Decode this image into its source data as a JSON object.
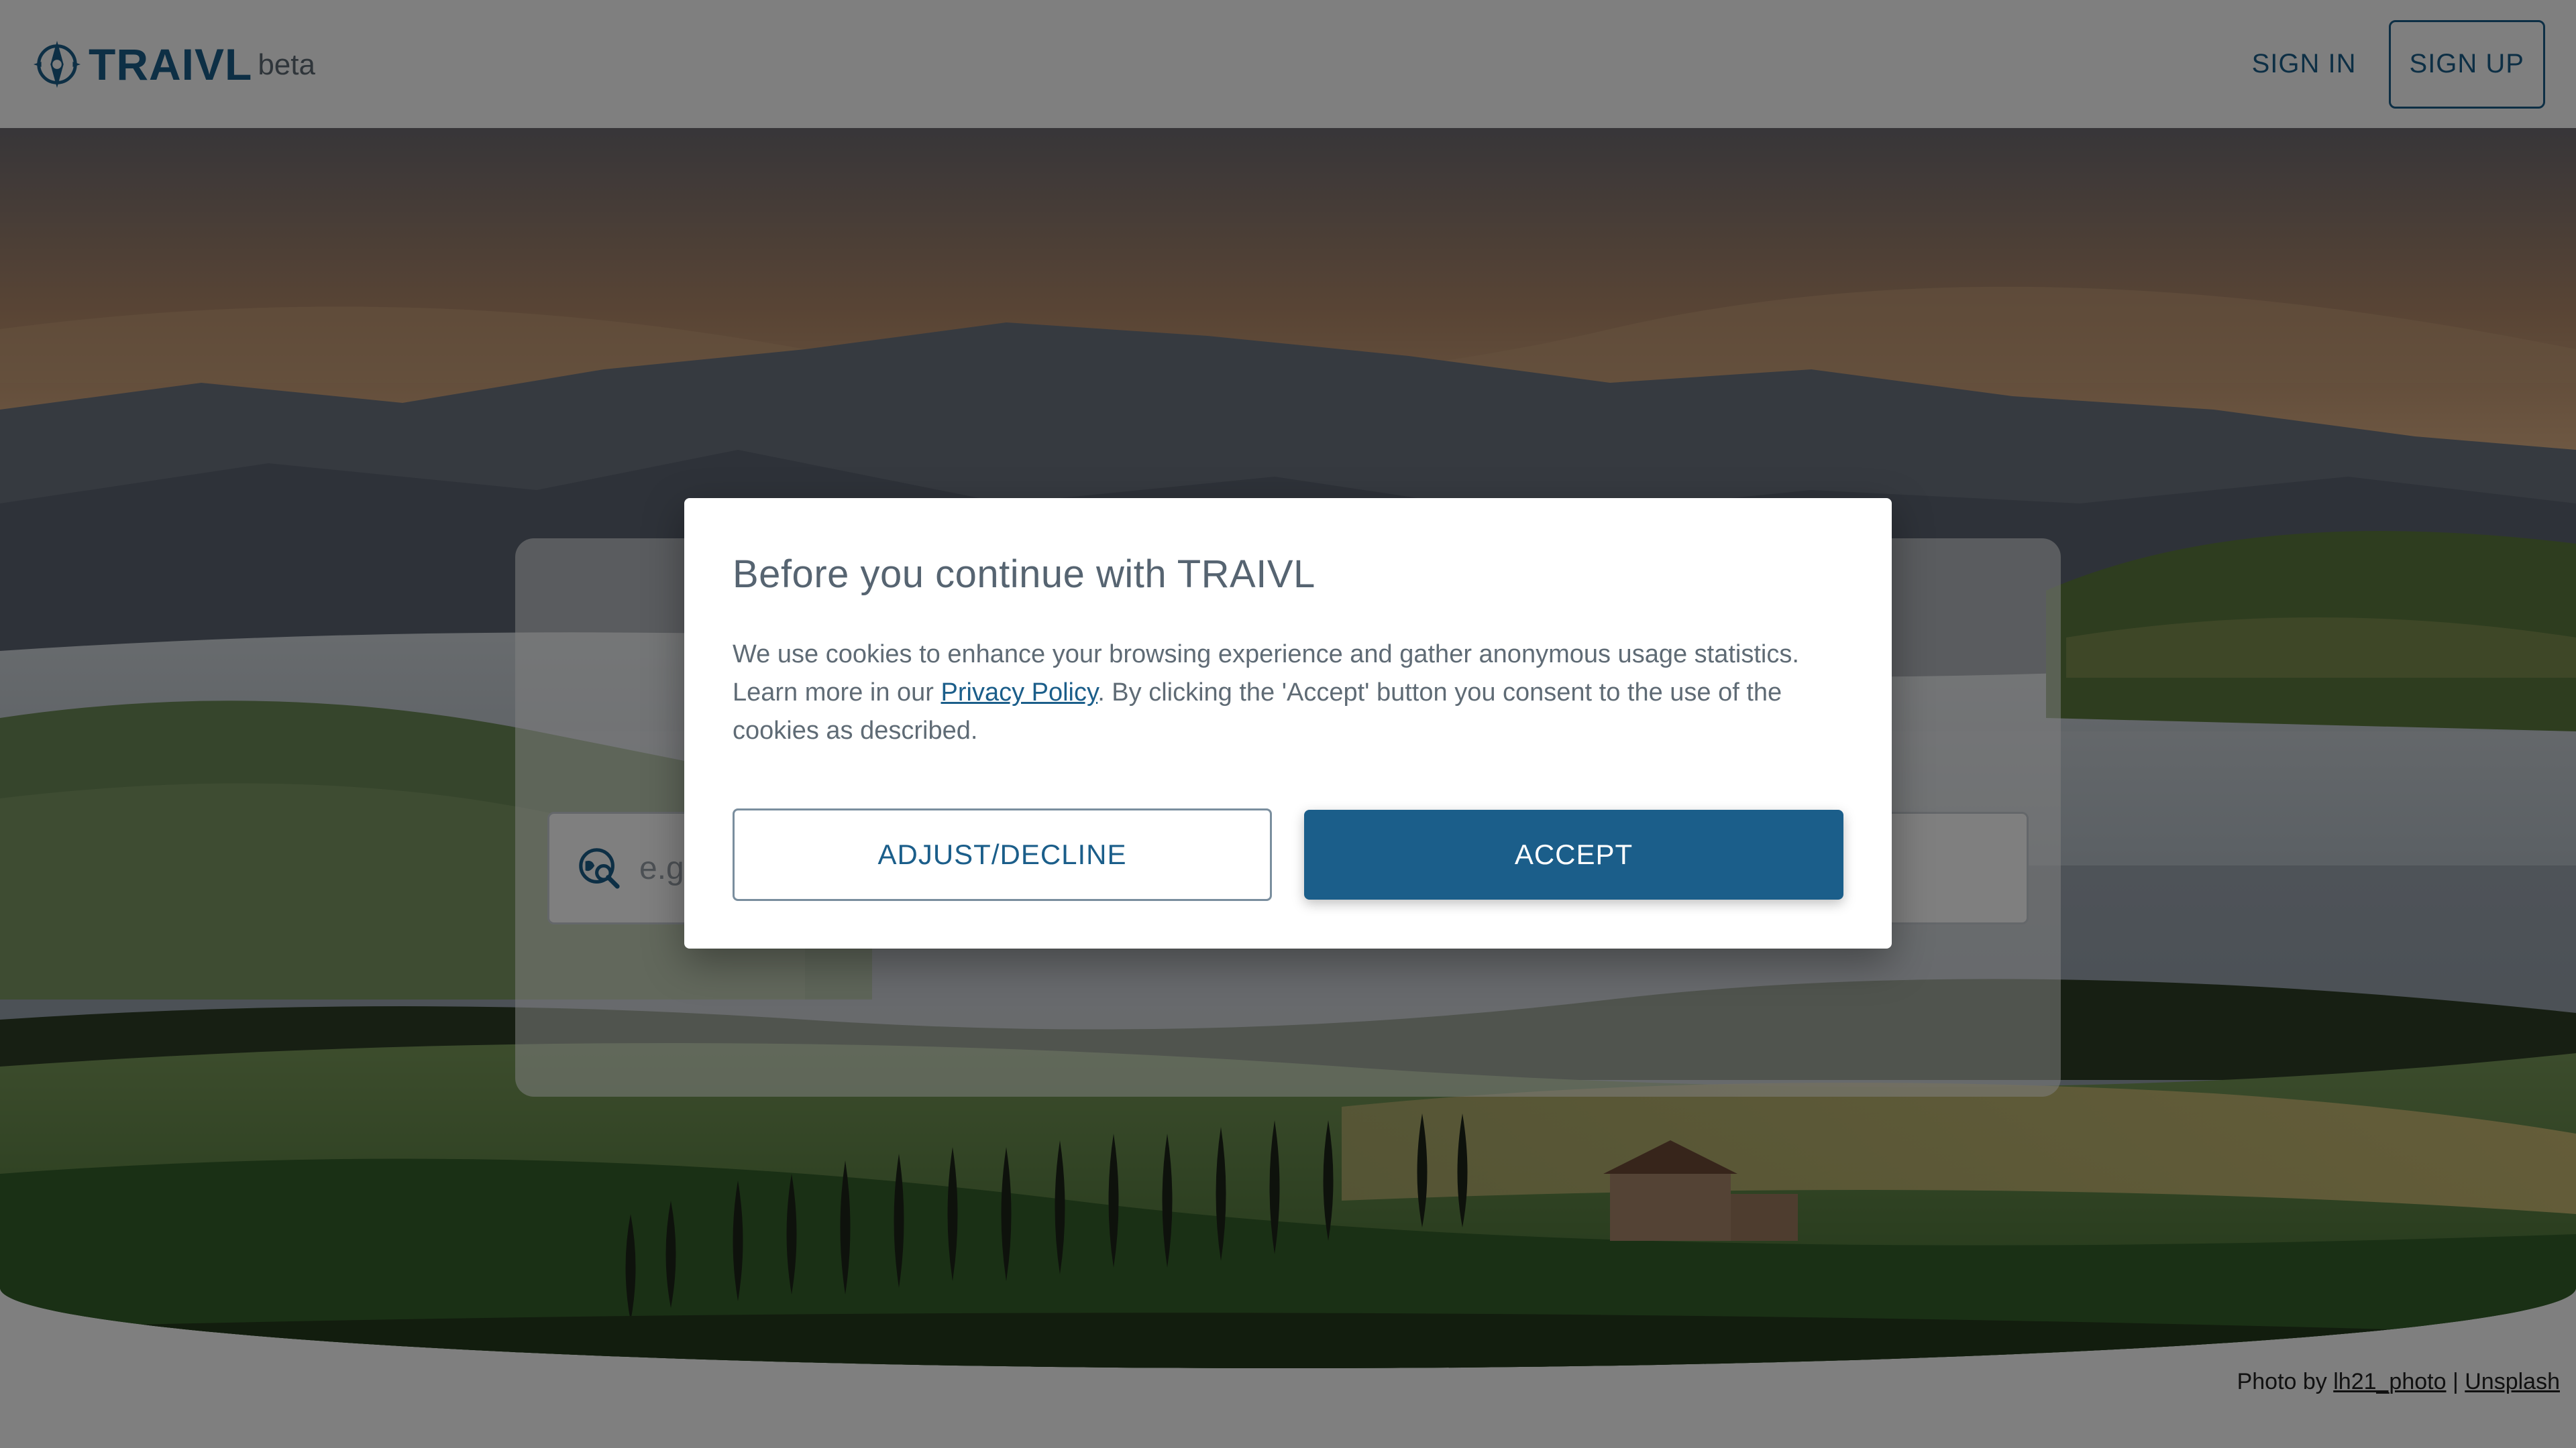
{
  "header": {
    "brand": "TRAIVL",
    "beta": "beta",
    "signin_label": "SIGN IN",
    "signup_label": "SIGN UP"
  },
  "search": {
    "placeholder": "e.g."
  },
  "photo_credit": {
    "prefix": "Photo by ",
    "author": "lh21_photo",
    "separator": " | ",
    "source": "Unsplash"
  },
  "cookie_modal": {
    "title": "Before you continue with TRAIVL",
    "body_before": "We use cookies to enhance your browsing experience and gather anonymous usage statistics. Learn more in our ",
    "privacy_link": "Privacy Policy",
    "body_after": ". By clicking the 'Accept' button you consent to the use of the cookies as described.",
    "decline_label": "ADJUST/DECLINE",
    "accept_label": "ACCEPT"
  },
  "colors": {
    "brand": "#1b5e8a",
    "overlay": "rgba(0,0,0,0.5)",
    "text_muted": "#5f6b75"
  }
}
